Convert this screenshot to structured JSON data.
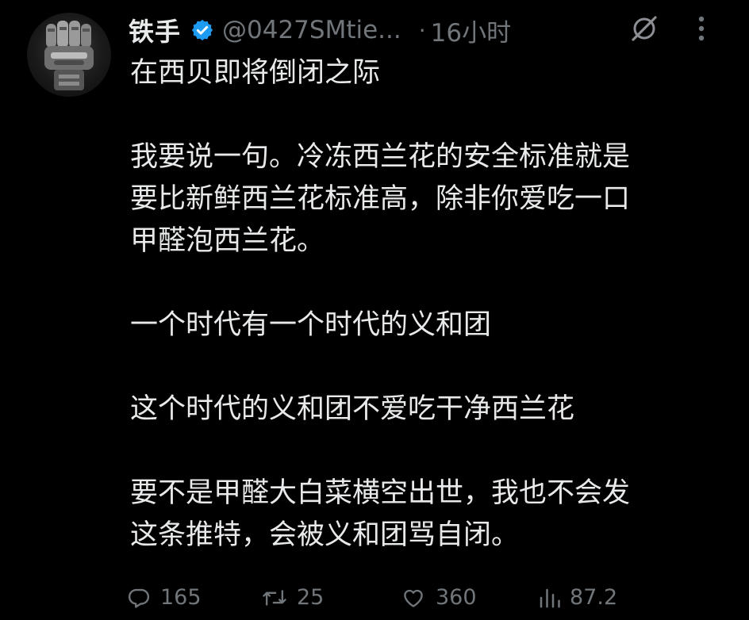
{
  "author": {
    "display_name": "铁手",
    "verified": true,
    "handle": "@0427SMtie...",
    "separator": "·",
    "time": "16小时"
  },
  "icons": {
    "avatar": "robot-fist-avatar",
    "verified": "verified-badge-icon",
    "grok": "grok-icon",
    "more": "more-vertical-icon",
    "reply": "reply-icon",
    "retweet": "retweet-icon",
    "like": "heart-icon",
    "views": "views-bar-chart-icon"
  },
  "colors": {
    "background": "#000000",
    "text": "#e7e9ea",
    "secondary": "#71767b",
    "verified": "#1d9bf0"
  },
  "tweet": {
    "lines": [
      "在西贝即将倒闭之际",
      "",
      "我要说一句。冷冻西兰花的安全标准就是",
      "要比新鲜西兰花标准高，除非你爱吃一口",
      "甲醛泡西兰花。",
      "",
      "一个时代有一个时代的义和团",
      "",
      "这个时代的义和团不爱吃干净西兰花",
      "",
      "要不是甲醛大白菜横空出世，我也不会发",
      "这条推特，会被义和团骂自闭。"
    ]
  },
  "metrics": {
    "replies": "165",
    "retweets": "25",
    "likes": "360",
    "views": "87.2"
  }
}
